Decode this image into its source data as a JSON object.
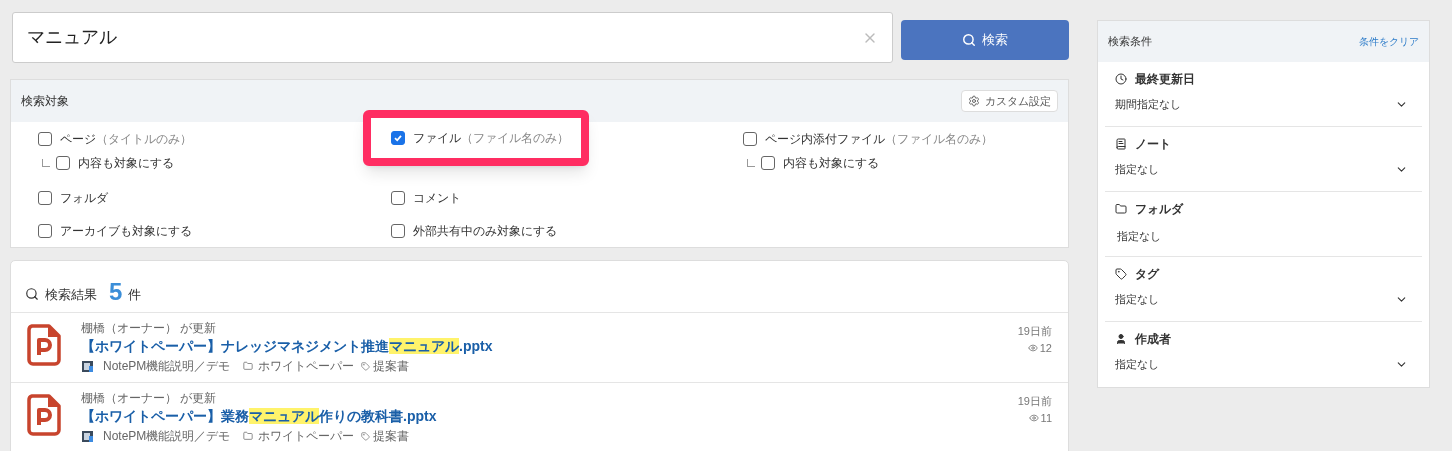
{
  "search": {
    "value": "マニュアル",
    "button": "検索"
  },
  "targets": {
    "title": "検索対象",
    "custom_button": "カスタム設定",
    "rows": [
      [
        {
          "label": "ページ",
          "note": "（タイトルのみ）",
          "checked": false,
          "highlighted": false,
          "children": [
            {
              "label": "内容も対象にする",
              "checked": false
            }
          ]
        },
        {
          "label": "ファイル",
          "note": "（ファイル名のみ）",
          "checked": true,
          "highlighted": true
        },
        {
          "label": "ページ内添付ファイル",
          "note": "（ファイル名のみ）",
          "checked": false,
          "highlighted": false,
          "children": [
            {
              "label": "内容も対象にする",
              "checked": false
            }
          ]
        }
      ],
      [
        {
          "label": "フォルダ",
          "checked": false,
          "highlighted": false
        },
        {
          "label": "コメント",
          "checked": false,
          "highlighted": false
        }
      ],
      [
        {
          "label": "アーカイブも対象にする",
          "checked": false,
          "highlighted": false
        },
        {
          "label": "外部共有中のみ対象にする",
          "checked": false,
          "highlighted": false
        }
      ]
    ]
  },
  "results": {
    "label": "検索結果",
    "count": "5",
    "unit": "件",
    "items": [
      {
        "updater": "棚橋（オーナー） が更新",
        "title": [
          {
            "text": "【ホワイトペーパー】ナレッジマネジメント推進",
            "highlight": false
          },
          {
            "text": "マニュアル",
            "highlight": true
          },
          {
            "text": ".pptx",
            "highlight": false
          }
        ],
        "note": "NotePM機能説明／デモ",
        "folder": "ホワイトペーパー",
        "tag": "提案書",
        "date": "19日前",
        "views": "12"
      },
      {
        "updater": "棚橋（オーナー） が更新",
        "title": [
          {
            "text": "【ホワイトペーパー】業務",
            "highlight": false
          },
          {
            "text": "マニュアル",
            "highlight": true
          },
          {
            "text": "作りの教科書.pptx",
            "highlight": false
          }
        ],
        "note": "NotePM機能説明／デモ",
        "folder": "ホワイトペーパー",
        "tag": "提案書",
        "date": "19日前",
        "views": "11"
      }
    ]
  },
  "conditions": {
    "title": "検索条件",
    "clear_link": "条件をクリア",
    "filters": [
      {
        "kind": "date",
        "label": "最終更新日",
        "value": "期間指定なし",
        "dropdown": true
      },
      {
        "kind": "note",
        "label": "ノート",
        "value": "指定なし",
        "dropdown": true
      },
      {
        "kind": "folder",
        "label": "フォルダ",
        "value": "指定なし",
        "dropdown": false
      },
      {
        "kind": "tag",
        "label": "タグ",
        "value": "指定なし",
        "dropdown": true
      },
      {
        "kind": "user",
        "label": "作成者",
        "value": "指定なし",
        "dropdown": true
      }
    ]
  }
}
